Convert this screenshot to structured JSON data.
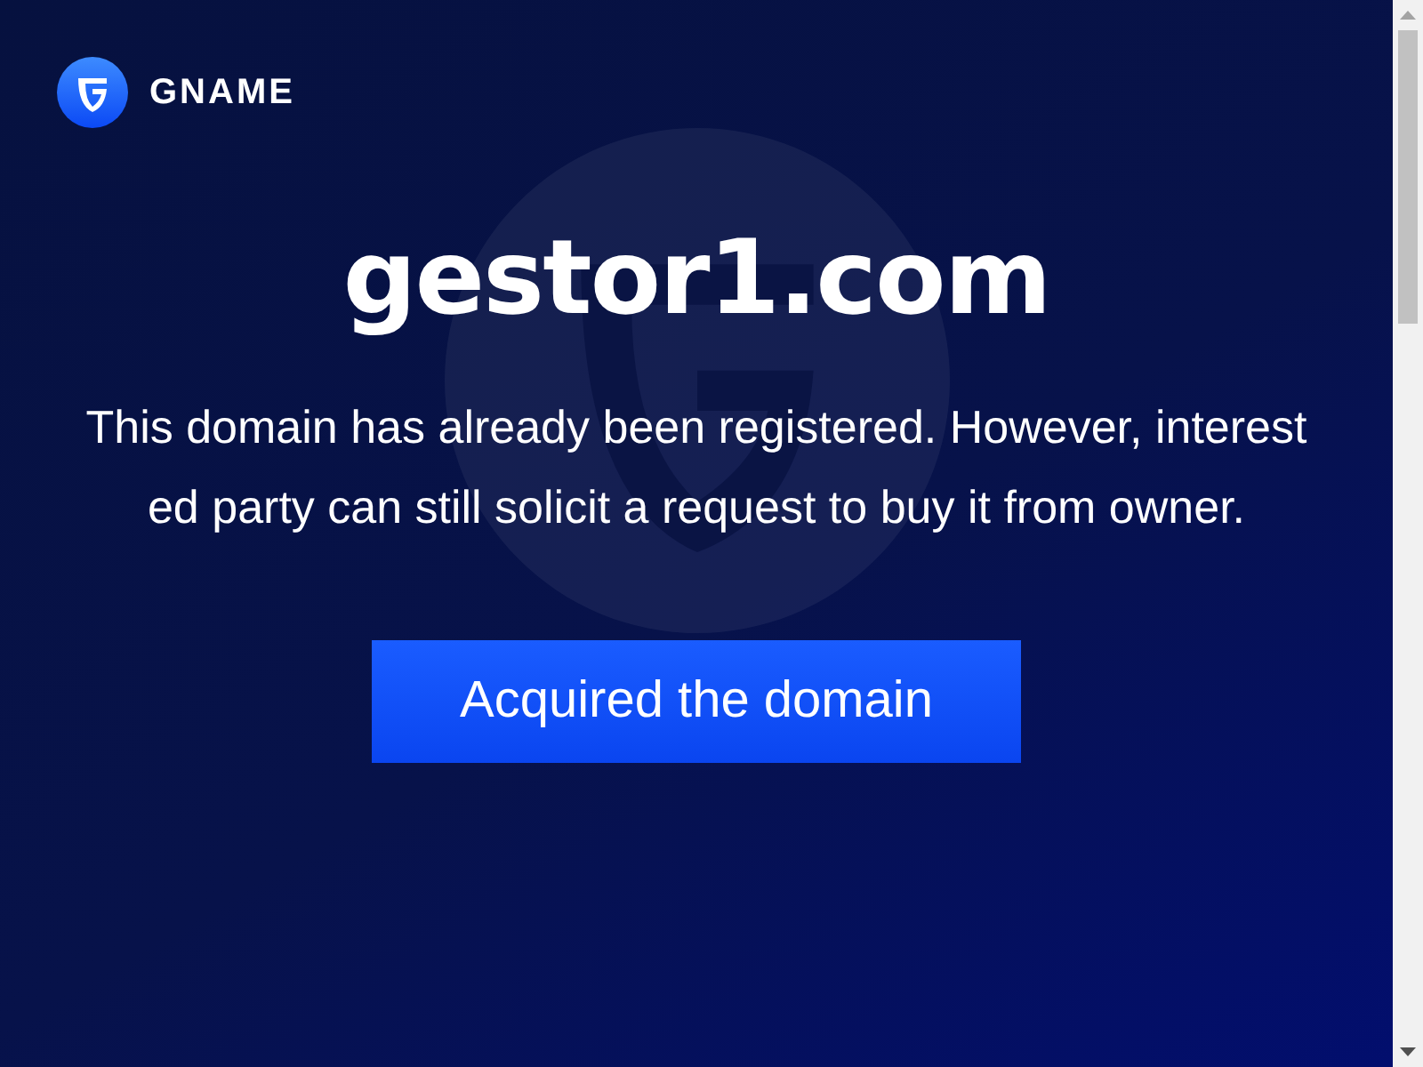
{
  "header": {
    "brand": "GNAME"
  },
  "domain": "gestor1.com",
  "message": "This domain has already been registered. However, interested party can still solicit a request to buy it from owner.",
  "button": "Acquired the domain"
}
